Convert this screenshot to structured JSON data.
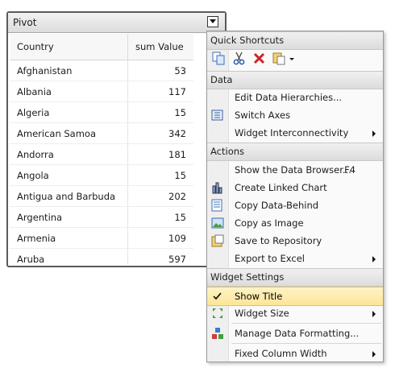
{
  "widget": {
    "title": "Pivot",
    "columns": [
      "Country",
      "sum Value"
    ],
    "rows": [
      {
        "country": "Afghanistan",
        "value": "53"
      },
      {
        "country": "Albania",
        "value": "117"
      },
      {
        "country": "Algeria",
        "value": "15"
      },
      {
        "country": "American Samoa",
        "value": "342"
      },
      {
        "country": "Andorra",
        "value": "181"
      },
      {
        "country": "Angola",
        "value": "15"
      },
      {
        "country": "Antigua and Barbuda",
        "value": "202"
      },
      {
        "country": "Argentina",
        "value": "15"
      },
      {
        "country": "Armenia",
        "value": "109"
      },
      {
        "country": "Aruba",
        "value": "597"
      }
    ]
  },
  "menu": {
    "quick_title": "Quick Shortcuts",
    "quick_icons": [
      "copy-icon",
      "cut-icon",
      "delete-icon",
      "paste-special-icon"
    ],
    "sections": {
      "data": "Data",
      "actions": "Actions",
      "widget_settings": "Widget Settings"
    },
    "items": {
      "edit_hierarchies": "Edit Data Hierarchies...",
      "switch_axes": "Switch Axes",
      "interconnectivity": "Widget Interconnectivity",
      "data_browser": "Show the Data Browser...",
      "data_browser_shortcut": "F4",
      "linked_chart": "Create Linked Chart",
      "copy_data": "Copy Data-Behind",
      "copy_image": "Copy as Image",
      "save_repo": "Save to Repository",
      "export_excel": "Export to Excel",
      "show_title": "Show Title",
      "widget_size": "Widget Size",
      "manage_formatting": "Manage Data Formatting...",
      "fixed_width": "Fixed Column Width"
    },
    "colors": {
      "highlight": "#fde598",
      "delete": "#d42020"
    }
  }
}
